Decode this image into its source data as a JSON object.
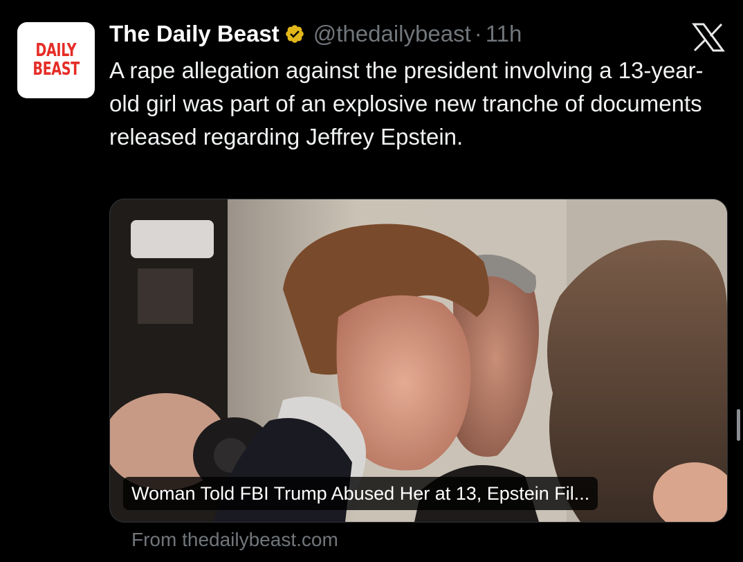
{
  "account": {
    "avatar_lines": [
      "DAILY",
      "BEAST"
    ],
    "display_name": "The Daily Beast",
    "handle": "@thedailybeast",
    "separator": "·",
    "time": "11h"
  },
  "icons": {
    "verified": "verified-badge-icon",
    "platform": "x-logo-icon"
  },
  "tweet": {
    "text": "A rape allegation against the president involving a 13-year-old girl was part of an explosive new tranche of documents released regarding Jeffrey Epstein."
  },
  "link_card": {
    "headline": "Woman Told FBI Trump Abused Her at 13, Epstein Fil...",
    "source": "From thedailybeast.com"
  },
  "colors": {
    "background": "#000000",
    "text": "#e7e9ea",
    "secondary_text": "#71767b",
    "verified_gold": "#e2b719",
    "brand_red": "#e52d27"
  }
}
